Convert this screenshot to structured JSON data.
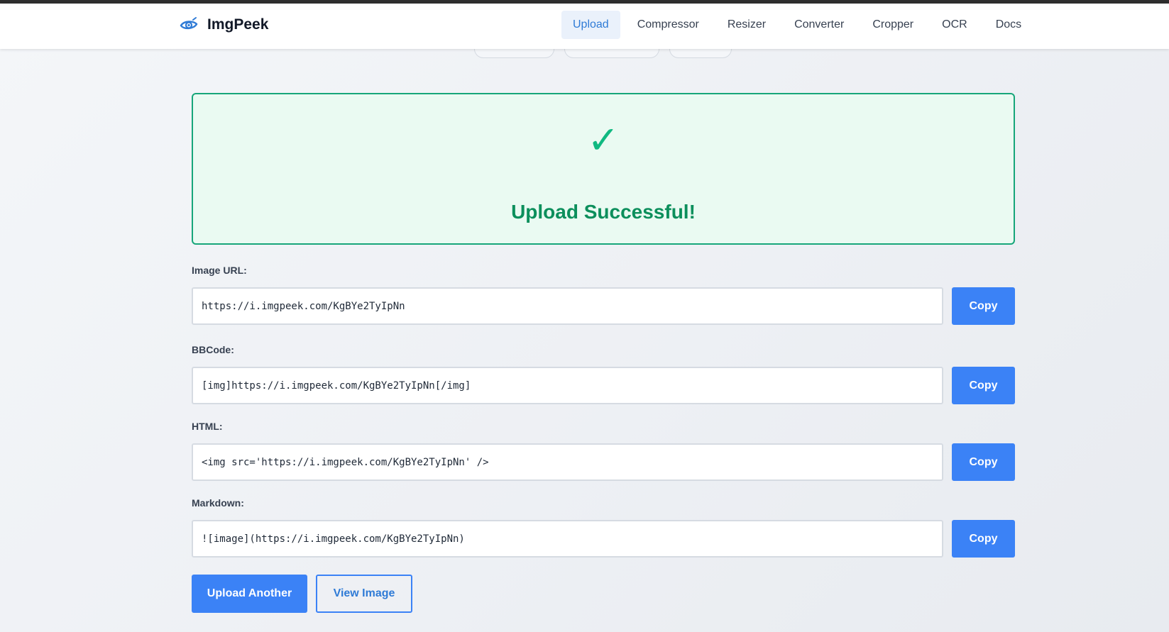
{
  "app": {
    "name": "ImgPeek"
  },
  "nav": {
    "items": [
      {
        "label": "Upload",
        "active": true
      },
      {
        "label": "Compressor"
      },
      {
        "label": "Resizer"
      },
      {
        "label": "Converter"
      },
      {
        "label": "Cropper"
      },
      {
        "label": "OCR"
      },
      {
        "label": "Docs"
      }
    ]
  },
  "success": {
    "icon": "check-mark-icon",
    "title": "Upload Successful!"
  },
  "fields": [
    {
      "label": "Image URL:",
      "value": "https://i.imgpeek.com/KgBYe2TyIpNn",
      "button": "Copy"
    },
    {
      "label": "BBCode:",
      "value": "[img]https://i.imgpeek.com/KgBYe2TyIpNn[/img]",
      "button": "Copy"
    },
    {
      "label": "HTML:",
      "value": "<img src='https://i.imgpeek.com/KgBYe2TyIpNn' />",
      "button": "Copy"
    },
    {
      "label": "Markdown:",
      "value": "![image](https://i.imgpeek.com/KgBYe2TyIpNn)",
      "button": "Copy"
    }
  ],
  "actions": {
    "upload_another": "Upload Another",
    "view_image": "View Image"
  },
  "colors": {
    "accent": "#3b82f6",
    "success": "#10b981",
    "success_bg": "#eafaf2"
  }
}
